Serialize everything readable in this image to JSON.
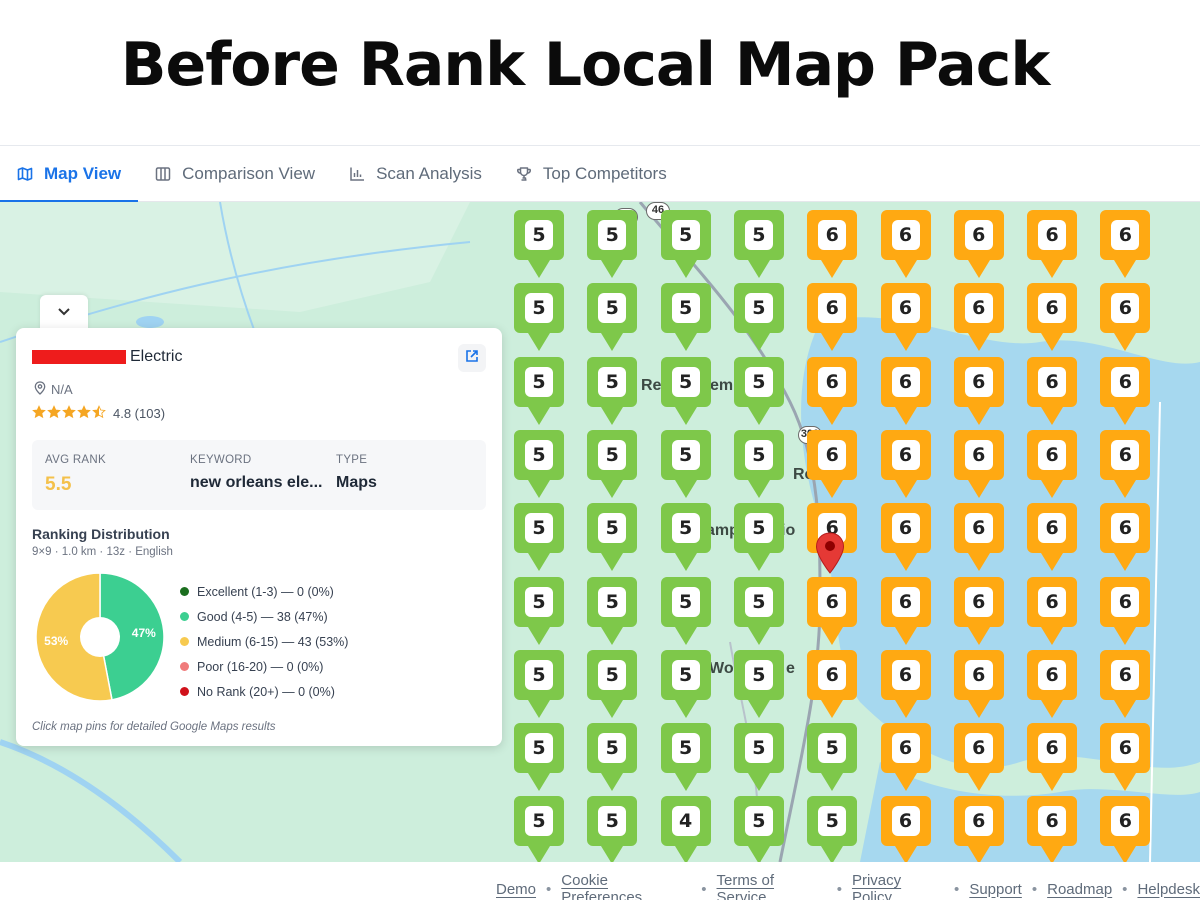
{
  "headline": "Before Rank Local Map Pack",
  "tabs": [
    {
      "label": "Map View",
      "icon": "map-icon",
      "active": true
    },
    {
      "label": "Comparison View",
      "icon": "columns-icon",
      "active": false
    },
    {
      "label": "Scan Analysis",
      "icon": "bar-chart-icon",
      "active": false
    },
    {
      "label": "Top Competitors",
      "icon": "trophy-icon",
      "active": false
    }
  ],
  "map": {
    "labels": [
      "Re",
      "em",
      "Re",
      "amp",
      "io",
      "Wo",
      "e"
    ],
    "route_shields": [
      "46",
      "300"
    ],
    "rank_colors": {
      "good": "#7ec84a",
      "medium": "#ffa912"
    },
    "grid": [
      [
        5,
        5,
        5,
        5,
        6,
        6,
        6,
        6,
        6
      ],
      [
        5,
        5,
        5,
        5,
        6,
        6,
        6,
        6,
        6
      ],
      [
        5,
        5,
        5,
        5,
        6,
        6,
        6,
        6,
        6
      ],
      [
        5,
        5,
        5,
        5,
        6,
        6,
        6,
        6,
        6
      ],
      [
        5,
        5,
        5,
        5,
        6,
        6,
        6,
        6,
        6
      ],
      [
        5,
        5,
        5,
        5,
        6,
        6,
        6,
        6,
        6
      ],
      [
        5,
        5,
        5,
        5,
        6,
        6,
        6,
        6,
        6
      ],
      [
        5,
        5,
        5,
        5,
        5,
        6,
        6,
        6,
        6
      ],
      [
        5,
        5,
        4,
        5,
        5,
        6,
        6,
        6,
        6
      ]
    ]
  },
  "panel": {
    "business_suffix": "Electric",
    "address": "N/A",
    "rating_value": 4.5,
    "rating_text": "4.8 (103)",
    "stats": {
      "avg_rank_label": "AVG RANK",
      "avg_rank_value": "5.5",
      "keyword_label": "KEYWORD",
      "keyword_value": "new orleans ele...",
      "type_label": "TYPE",
      "type_value": "Maps"
    },
    "distribution_title": "Ranking Distribution",
    "distribution_subtitle": "9×9 · 1.0 km · 13z · English",
    "legend": [
      {
        "label": "Excellent (1-3) — 0 (0%)",
        "color": "#1b6e1f"
      },
      {
        "label": "Good (4-5) — 38 (47%)",
        "color": "#3ccf91"
      },
      {
        "label": "Medium (6-15) — 43 (53%)",
        "color": "#f7ca50"
      },
      {
        "label": "Poor (16-20) — 0 (0%)",
        "color": "#f07b7b"
      },
      {
        "label": "No Rank (20+) — 0 (0%)",
        "color": "#d0121b"
      }
    ],
    "hint": "Click map pins for detailed Google Maps results"
  },
  "chart_data": {
    "type": "pie",
    "categories": [
      "Good (4-5)",
      "Medium (6-15)"
    ],
    "values": [
      47,
      53
    ],
    "slice_labels": [
      "47%",
      "53%"
    ],
    "colors": [
      "#3ccf91",
      "#f7ca50"
    ]
  },
  "footer": {
    "links": [
      "Demo",
      "Cookie Preferences",
      "Terms of Service",
      "Privacy Policy",
      "Support",
      "Roadmap",
      "Helpdesk"
    ]
  }
}
